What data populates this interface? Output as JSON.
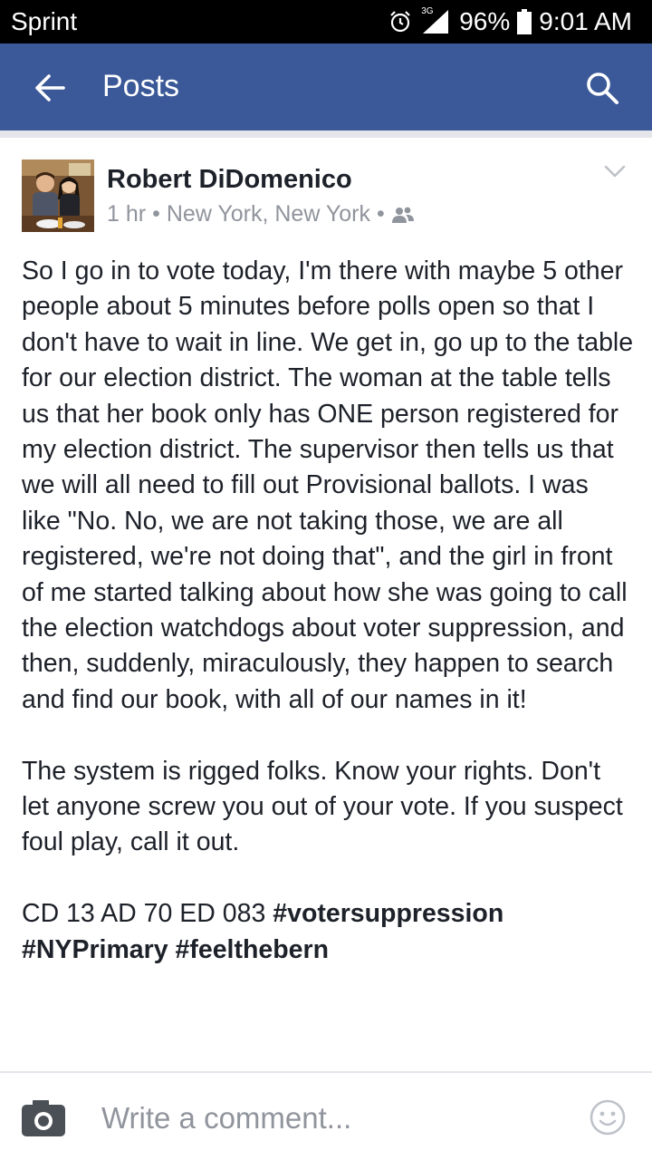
{
  "status_bar": {
    "carrier": "Sprint",
    "network": "3G",
    "battery": "96%",
    "time": "9:01 AM",
    "icons": [
      "alarm-icon",
      "signal-icon",
      "battery-icon"
    ]
  },
  "app_bar": {
    "title": "Posts",
    "color": "#3b5998",
    "icons": [
      "back-arrow-icon",
      "search-icon"
    ]
  },
  "post": {
    "author": "Robert DiDomenico",
    "time": "1 hr",
    "separator": "•",
    "location": "New York, New York",
    "audience_icon": "friends-icon",
    "menu_icon": "chevron-down-icon",
    "paragraph_1": "So I go in to vote today, I'm there with maybe 5 other people about 5 minutes before polls open so that I don't have to wait in line. We get in, go up to the table for our election district. The woman at the table tells us that her book only has ONE person registered for my election district. The supervisor then tells us that we will all need to fill out Provisional ballots. I was like \"No. No, we are not taking those, we are all registered, we're not doing that\", and the girl in front of me started talking about how she was going to call the election watchdogs about voter suppression, and then, suddenly, miraculously, they happen to search and find our book, with all of our names in it!",
    "paragraph_2": "The system is rigged folks. Know your rights. Don't let anyone screw you out of your vote. If you suspect foul play, call it out.",
    "paragraph_3_text": "CD 13 AD 70 ED 083",
    "hashtags": [
      "#votersuppression",
      "#NYPrimary",
      "#feelthebern"
    ]
  },
  "comment_bar": {
    "placeholder": "Write a comment...",
    "icons": [
      "camera-icon",
      "emoji-icon"
    ]
  }
}
